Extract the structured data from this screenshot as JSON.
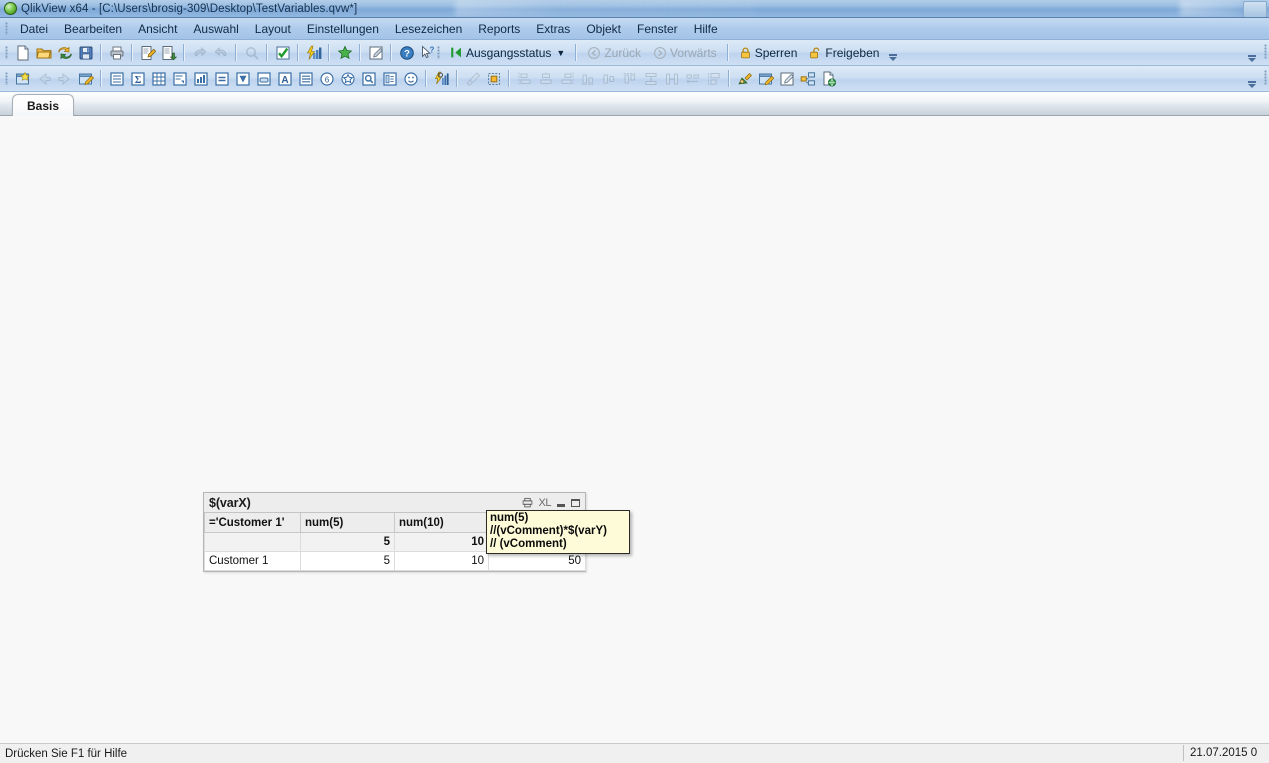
{
  "window": {
    "title": "QlikView x64 - [C:\\Users\\brosig-309\\Desktop\\TestVariables.qvw*]",
    "app_icon": "qlikview-logo-icon"
  },
  "menu": {
    "items": [
      {
        "label": "Datei"
      },
      {
        "label": "Bearbeiten"
      },
      {
        "label": "Ansicht"
      },
      {
        "label": "Auswahl"
      },
      {
        "label": "Layout"
      },
      {
        "label": "Einstellungen"
      },
      {
        "label": "Lesezeichen"
      },
      {
        "label": "Reports"
      },
      {
        "label": "Extras"
      },
      {
        "label": "Objekt"
      },
      {
        "label": "Fenster"
      },
      {
        "label": "Hilfe"
      }
    ]
  },
  "toolbar_standard": {
    "buttons": [
      {
        "name": "new-document-icon",
        "title": "Neu"
      },
      {
        "name": "open-document-icon",
        "title": "Öffnen"
      },
      {
        "name": "reload-icon",
        "title": "Neu laden"
      },
      {
        "name": "save-icon",
        "title": "Speichern"
      },
      {
        "name": "print-icon",
        "title": "Drucken"
      },
      {
        "name": "edit-script-icon",
        "title": "Skript bearbeiten"
      },
      {
        "name": "table-viewer-icon",
        "title": "Tabellen-Viewer"
      },
      {
        "name": "undo-icon",
        "title": "Rückgängig"
      },
      {
        "name": "redo-icon",
        "title": "Wiederherstellen"
      },
      {
        "name": "search-icon",
        "title": "Suchen"
      },
      {
        "name": "current-selections-icon",
        "title": "Aktuelle Auswahl"
      },
      {
        "name": "chart-wizard-icon",
        "title": "Diagramm-Assistent"
      },
      {
        "name": "favorites-star-icon",
        "title": "Lesezeichen"
      },
      {
        "name": "edit-module-icon",
        "title": "Modul bearbeiten"
      },
      {
        "name": "help-icon",
        "title": "Hilfe"
      },
      {
        "name": "context-help-icon",
        "title": "Direkthilfe"
      }
    ],
    "clear_state_label": "Ausgangsstatus",
    "back_label": "Zurück",
    "forward_label": "Vorwärts",
    "lock_label": "Sperren",
    "unlock_label": "Freigeben"
  },
  "toolbar_design": {
    "buttons": [
      {
        "name": "new-sheet-icon",
        "title": "Neues Arbeitsblatt"
      },
      {
        "name": "promote-sheet-left-icon",
        "title": "Arbeitsblatt nach links"
      },
      {
        "name": "promote-sheet-right-icon",
        "title": "Arbeitsblatt nach rechts"
      },
      {
        "name": "sheet-properties-icon",
        "title": "Arbeitsblatt-Eigenschaften"
      },
      {
        "name": "new-listbox-icon",
        "title": "Neue Listbox"
      },
      {
        "name": "new-statistics-box-icon",
        "title": "Neue Statistikbox"
      },
      {
        "name": "new-table-box-icon",
        "title": "Neue Tabellenbox"
      },
      {
        "name": "new-multi-box-icon",
        "title": "Neue Multibox"
      },
      {
        "name": "new-chart-icon",
        "title": "Neues Diagramm"
      },
      {
        "name": "new-input-box-icon",
        "title": "Neue Eingabebox"
      },
      {
        "name": "new-current-selections-box-icon",
        "title": "Neue Auswahlbox"
      },
      {
        "name": "new-button-icon",
        "title": "Neuer Button"
      },
      {
        "name": "new-text-object-icon",
        "title": "Neues Textobjekt"
      },
      {
        "name": "new-line-arrow-icon",
        "title": "Neues Linien-/Pfeilobjekt"
      },
      {
        "name": "new-slider-calendar-icon",
        "title": "Neues Slider/Kalender-Objekt"
      },
      {
        "name": "new-bookmark-object-icon",
        "title": "Neues Lesezeichen-Objekt"
      },
      {
        "name": "new-search-object-icon",
        "title": "Neues Suchobjekt"
      },
      {
        "name": "new-container-icon",
        "title": "Neuer Container"
      },
      {
        "name": "new-custom-object-icon",
        "title": "Neues Custom-Objekt"
      },
      {
        "name": "properties-icon",
        "title": "Eigenschaften"
      },
      {
        "name": "clear-formatting-icon",
        "title": "Format löschen"
      },
      {
        "name": "activate-all-icon",
        "title": "Alle aktivieren"
      },
      {
        "name": "align-left-icon",
        "title": "Links ausrichten"
      },
      {
        "name": "align-center-h-icon",
        "title": "Horizontal zentrieren"
      },
      {
        "name": "align-right-icon",
        "title": "Rechts ausrichten"
      },
      {
        "name": "align-bottom-icon",
        "title": "Unten ausrichten"
      },
      {
        "name": "align-middle-icon",
        "title": "Vertikal zentrieren"
      },
      {
        "name": "align-top-icon",
        "title": "Oben ausrichten"
      },
      {
        "name": "distribute-vertical-icon",
        "title": "Vertikal verteilen"
      },
      {
        "name": "distribute-horizontal-icon",
        "title": "Horizontal verteilen"
      },
      {
        "name": "space-equally-h-icon",
        "title": "Gleichmäßig horizontal"
      },
      {
        "name": "space-equally-v-icon",
        "title": "Gleichmäßig vertikal"
      },
      {
        "name": "theme-maker-icon",
        "title": "Theme-Assistent"
      },
      {
        "name": "document-properties-icon",
        "title": "Dokument-Eigenschaften"
      },
      {
        "name": "user-preferences-icon",
        "title": "Benutzereinstellungen"
      },
      {
        "name": "sheet-object-links-icon",
        "title": "Objektverknüpfungen"
      },
      {
        "name": "publish-icon",
        "title": "Veröffentlichen"
      }
    ]
  },
  "tabs": [
    {
      "label": "Basis",
      "active": true
    }
  ],
  "chart_object": {
    "caption_title": "$(varX)",
    "caption_icons": [
      {
        "name": "print-object-icon"
      },
      {
        "name": "export-to-excel-icon",
        "label": "XL"
      },
      {
        "name": "minimize-object-icon"
      },
      {
        "name": "maximize-object-icon"
      }
    ],
    "columns": [
      {
        "label": "='Customer 1'",
        "align": "left"
      },
      {
        "label": "num(5)",
        "align": "right"
      },
      {
        "label": "num(10)",
        "align": "right"
      },
      {
        "label": "num(5)",
        "align": "right"
      }
    ],
    "total_row": [
      "",
      "5",
      "10",
      "50"
    ],
    "rows": [
      [
        "Customer 1",
        "5",
        "10",
        "50"
      ]
    ]
  },
  "tooltip": {
    "lines": [
      "num(5)",
      "//(vComment)*$(varY)",
      "// (vComment)"
    ]
  },
  "statusbar": {
    "hint": "Drücken Sie F1 für Hilfe",
    "date": "21.07.2015 0"
  }
}
